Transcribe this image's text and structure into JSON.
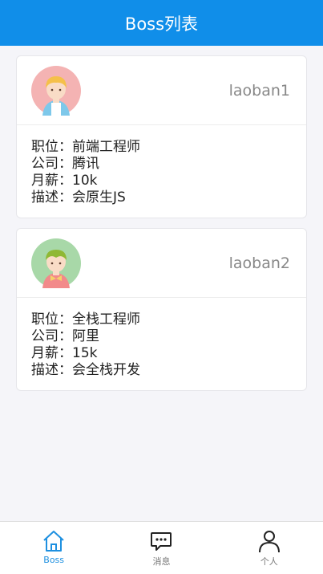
{
  "navbar": {
    "title": "Boss列表"
  },
  "bosses": [
    {
      "username": "laoban1",
      "avatar_icon": "girl-avatar-icon",
      "fields": [
        "职位：前端工程师",
        "公司：腾讯",
        "月薪：10k",
        "描述：会原生JS"
      ]
    },
    {
      "username": "laoban2",
      "avatar_icon": "boy-avatar-icon",
      "fields": [
        "职位：全栈工程师",
        "公司：阿里",
        "月薪：15k",
        "描述：会全栈开发"
      ]
    }
  ],
  "tabbar": {
    "items": [
      {
        "label": "Boss",
        "icon": "home-icon",
        "active": true
      },
      {
        "label": "消息",
        "icon": "message-icon",
        "active": false
      },
      {
        "label": "个人",
        "icon": "person-icon",
        "active": false
      }
    ]
  },
  "colors": {
    "primary": "#108ee9",
    "background": "#f5f5f9",
    "active_tab": "#1e90e0"
  }
}
